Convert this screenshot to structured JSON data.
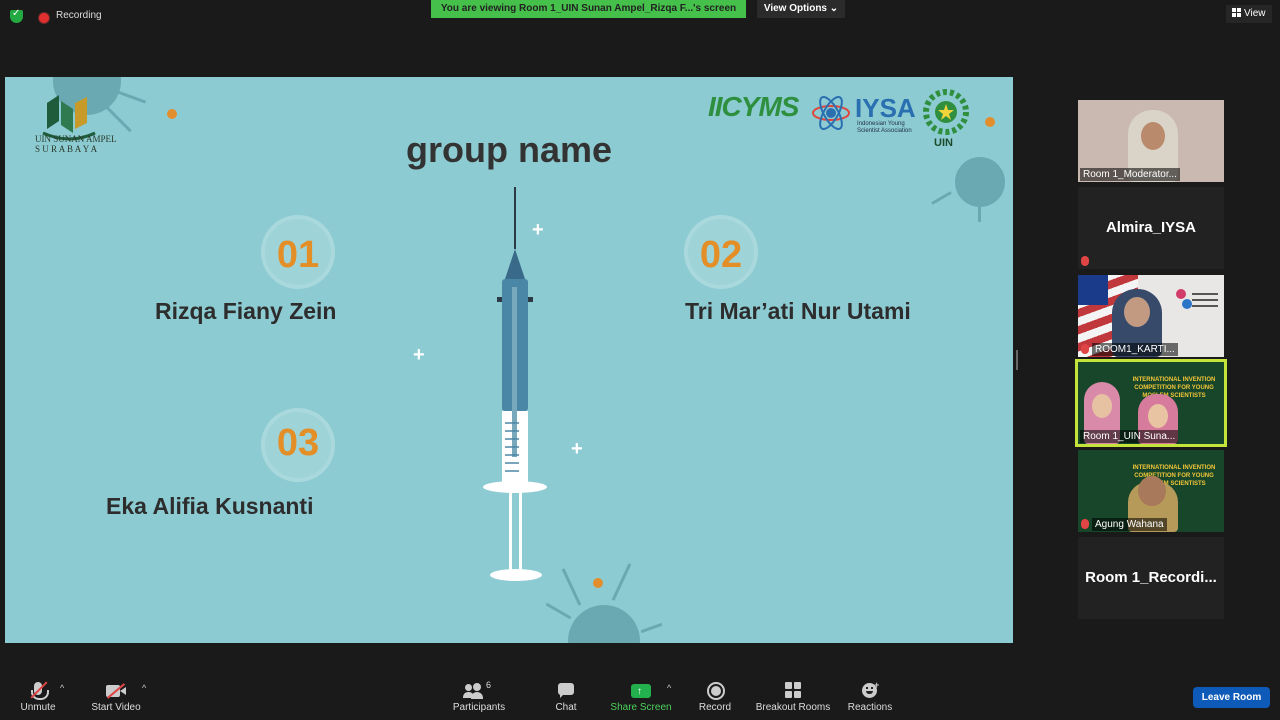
{
  "top": {
    "recording_label": "Recording",
    "banner_text": "You are viewing Room 1_UIN Sunan Ampel_Rizqa F...'s screen",
    "view_options_label": "View Options ⌄",
    "view_label": "View"
  },
  "slide": {
    "title": "group name",
    "uin_logo_text": "UIN SUNAN AMPEL\nS U R A B A Y A",
    "logos": [
      "IICYMS",
      "IYSA",
      "Indonesian Young Scientist Association",
      "UIN"
    ],
    "members": [
      {
        "number": "01",
        "name": "Rizqa Fiany Zein"
      },
      {
        "number": "02",
        "name": "Tri Mar’ati Nur Utami"
      },
      {
        "number": "03",
        "name": "Eka Alifia Kusnanti"
      }
    ]
  },
  "participants": [
    {
      "label": "Room 1_Moderator..."
    },
    {
      "label": "Almira_IYSA"
    },
    {
      "label": "ROOM1_KARTI..."
    },
    {
      "label": "Room 1_UIN Suna..."
    },
    {
      "label": "Agung Wahana"
    },
    {
      "label": "Room 1_Recordi..."
    }
  ],
  "toolbar": {
    "unmute": "Unmute",
    "start_video": "Start Video",
    "participants": "Participants",
    "participants_count": "6",
    "chat": "Chat",
    "share_screen": "Share Screen",
    "record": "Record",
    "breakout_rooms": "Breakout Rooms",
    "reactions": "Reactions",
    "leave_room": "Leave Room"
  },
  "colors": {
    "banner": "#45c04a",
    "slide_bg": "#8ccbd2",
    "number_accent": "#e38e26",
    "leave": "#0e5ab8",
    "active_tile": "#c4e43c"
  }
}
